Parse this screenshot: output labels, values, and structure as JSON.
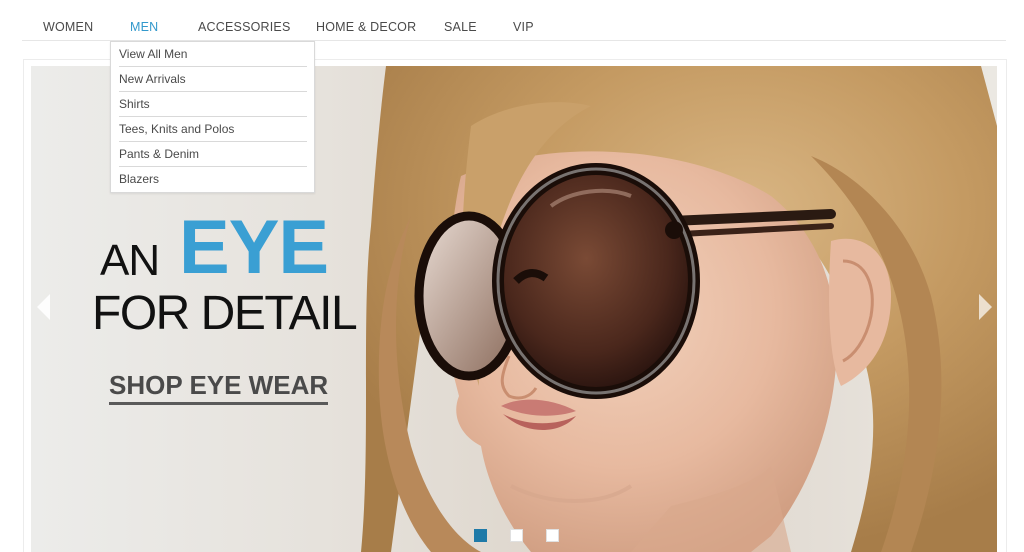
{
  "nav": {
    "items": [
      {
        "label": "WOMEN",
        "active": false
      },
      {
        "label": "MEN",
        "active": true
      },
      {
        "label": "ACCESSORIES",
        "active": false
      },
      {
        "label": "HOME & DECOR",
        "active": false
      },
      {
        "label": "SALE",
        "active": false
      },
      {
        "label": "VIP",
        "active": false
      }
    ],
    "active_color": "#3399cc"
  },
  "dropdown": {
    "items": [
      "View All Men",
      "New Arrivals",
      "Shirts",
      "Tees, Knits and Polos",
      "Pants & Denim",
      "Blazers"
    ]
  },
  "banner": {
    "headline_an": "AN",
    "headline_eye": "EYE",
    "headline_detail": "FOR DETAIL",
    "cta": "SHOP EYE WEAR",
    "accent_color": "#3a9fd3",
    "prev_icon": "chevron-left-icon",
    "next_icon": "chevron-right-icon",
    "slides_total": 3,
    "active_slide": 1
  }
}
